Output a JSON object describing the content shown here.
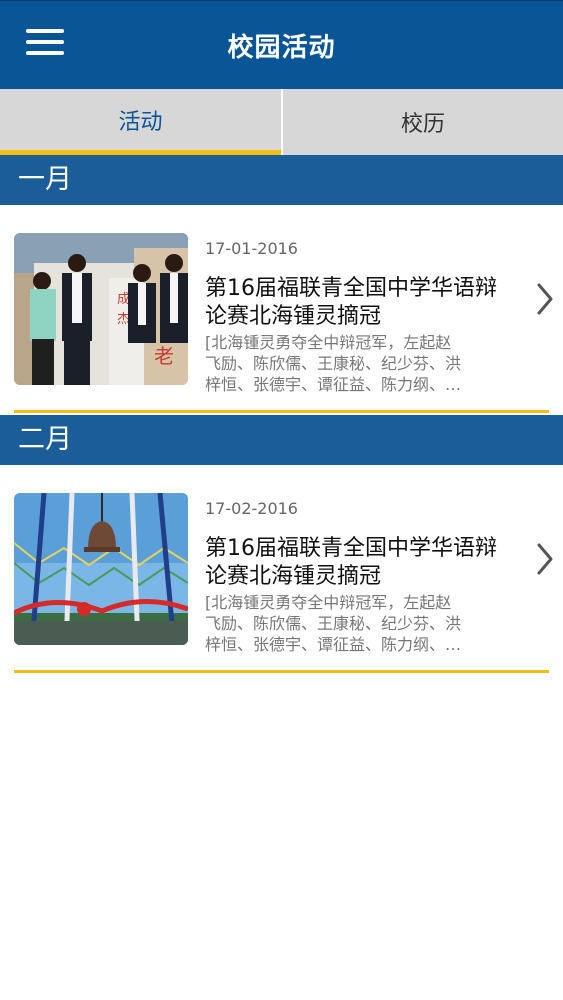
{
  "header": {
    "title": "校园活动"
  },
  "tabs": [
    {
      "label": "活动",
      "active": true
    },
    {
      "label": "校历",
      "active": false
    }
  ],
  "sections": [
    {
      "month": "一月",
      "item": {
        "date": "17-01-2016",
        "title": "第16届福联青全国中学华语辩论赛北海锺灵摘冠",
        "summary_lines": [
          "[北海锺灵勇夺全中辩冠军，左起赵",
          "飞励、陈欣儒、王康秘、纪少芬、洪",
          "梓恒、张德宇、谭征益、陈力纲、…"
        ]
      }
    },
    {
      "month": "二月",
      "item": {
        "date": "17-02-2016",
        "title": "第16届福联青全国中学华语辩论赛北海锺灵摘冠",
        "summary_lines": [
          "[北海锺灵勇夺全中辩冠军，左起赵",
          "飞励、陈欣儒、王康秘、纪少芬、洪",
          "梓恒、张德宇、谭征益、陈力纲、…"
        ]
      }
    }
  ],
  "icons": {
    "menu": "hamburger-menu-icon",
    "chevron": "chevron-right-icon"
  },
  "colors": {
    "header": "#0a5595",
    "month_bar": "#1a5d99",
    "accent": "#f2be14",
    "tab_bg": "#d7d7d7"
  }
}
